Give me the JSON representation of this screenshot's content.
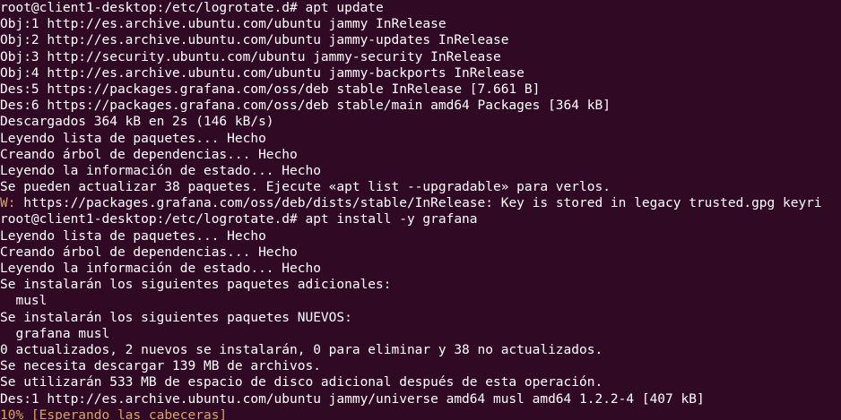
{
  "terminal": {
    "colors": {
      "background": "#300a24",
      "foreground": "#ffffff",
      "warning_prefix": "#d9a560",
      "progress": "#d9a560"
    },
    "lines": [
      {
        "kind": "normal",
        "prefix": "",
        "text": "root@client1-desktop:/etc/logrotate.d# apt update"
      },
      {
        "kind": "normal",
        "prefix": "",
        "text": "Obj:1 http://es.archive.ubuntu.com/ubuntu jammy InRelease"
      },
      {
        "kind": "normal",
        "prefix": "",
        "text": "Obj:2 http://es.archive.ubuntu.com/ubuntu jammy-updates InRelease"
      },
      {
        "kind": "normal",
        "prefix": "",
        "text": "Obj:3 http://security.ubuntu.com/ubuntu jammy-security InRelease"
      },
      {
        "kind": "normal",
        "prefix": "",
        "text": "Obj:4 http://es.archive.ubuntu.com/ubuntu jammy-backports InRelease"
      },
      {
        "kind": "normal",
        "prefix": "",
        "text": "Des:5 https://packages.grafana.com/oss/deb stable InRelease [7.661 B]"
      },
      {
        "kind": "normal",
        "prefix": "",
        "text": "Des:6 https://packages.grafana.com/oss/deb stable/main amd64 Packages [364 kB]"
      },
      {
        "kind": "normal",
        "prefix": "",
        "text": "Descargados 364 kB en 2s (146 kB/s)"
      },
      {
        "kind": "normal",
        "prefix": "",
        "text": "Leyendo lista de paquetes... Hecho"
      },
      {
        "kind": "normal",
        "prefix": "",
        "text": "Creando árbol de dependencias... Hecho"
      },
      {
        "kind": "normal",
        "prefix": "",
        "text": "Leyendo la información de estado... Hecho"
      },
      {
        "kind": "normal",
        "prefix": "",
        "text": "Se pueden actualizar 38 paquetes. Ejecute «apt list --upgradable» para verlos."
      },
      {
        "kind": "warn",
        "prefix": "W:",
        "text": " https://packages.grafana.com/oss/deb/dists/stable/InRelease: Key is stored in legacy trusted.gpg keyri"
      },
      {
        "kind": "normal",
        "prefix": "",
        "text": "root@client1-desktop:/etc/logrotate.d# apt install -y grafana"
      },
      {
        "kind": "normal",
        "prefix": "",
        "text": "Leyendo lista de paquetes... Hecho"
      },
      {
        "kind": "normal",
        "prefix": "",
        "text": "Creando árbol de dependencias... Hecho"
      },
      {
        "kind": "normal",
        "prefix": "",
        "text": "Leyendo la información de estado... Hecho"
      },
      {
        "kind": "normal",
        "prefix": "",
        "text": "Se instalarán los siguientes paquetes adicionales:"
      },
      {
        "kind": "normal",
        "prefix": "",
        "text": "  musl"
      },
      {
        "kind": "normal",
        "prefix": "",
        "text": "Se instalarán los siguientes paquetes NUEVOS:"
      },
      {
        "kind": "normal",
        "prefix": "",
        "text": "  grafana musl"
      },
      {
        "kind": "normal",
        "prefix": "",
        "text": "0 actualizados, 2 nuevos se instalarán, 0 para eliminar y 38 no actualizados."
      },
      {
        "kind": "normal",
        "prefix": "",
        "text": "Se necesita descargar 139 MB de archivos."
      },
      {
        "kind": "normal",
        "prefix": "",
        "text": "Se utilizarán 533 MB de espacio de disco adicional después de esta operación."
      },
      {
        "kind": "normal",
        "prefix": "",
        "text": "Des:1 http://es.archive.ubuntu.com/ubuntu jammy/universe amd64 musl amd64 1.2.2-4 [407 kB]"
      },
      {
        "kind": "progress",
        "prefix": "",
        "text": "10% [Esperando las cabeceras]"
      }
    ]
  }
}
